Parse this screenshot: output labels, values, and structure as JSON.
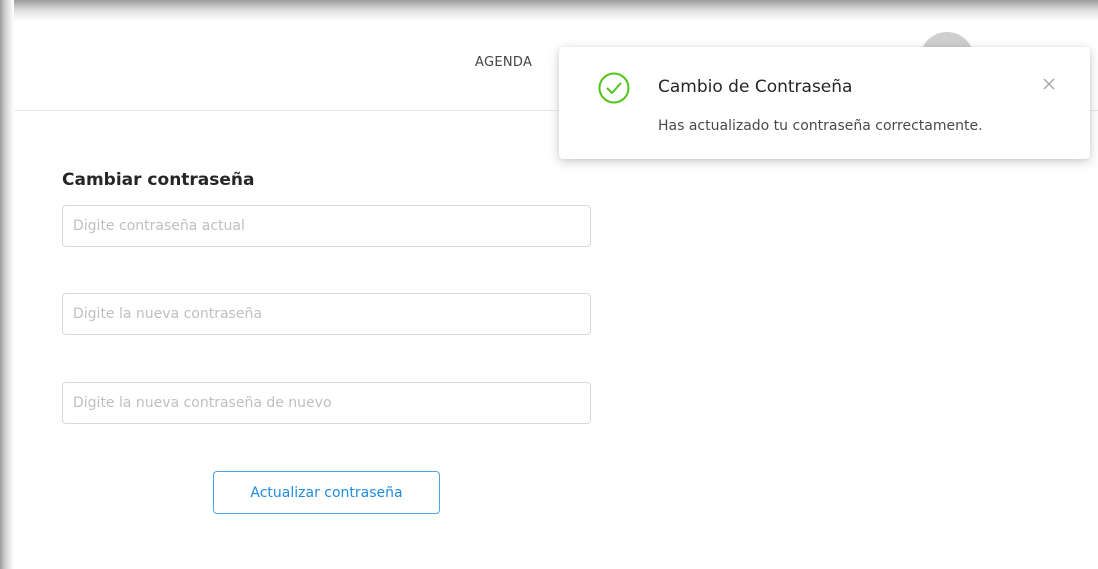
{
  "nav": {
    "agenda_label": "AGENDA"
  },
  "form": {
    "title": "Cambiar contraseña",
    "current_password": {
      "placeholder": "Digite contraseña actual",
      "value": ""
    },
    "new_password": {
      "placeholder": "Digite la nueva contraseña",
      "value": ""
    },
    "confirm_password": {
      "placeholder": "Digite la nueva contraseña de nuevo",
      "value": ""
    },
    "submit_label": "Actualizar contraseña"
  },
  "notification": {
    "title": "Cambio de Contraseña",
    "message": "Has actualizado tu contraseña correctamente.",
    "icon": "check-circle-icon",
    "close_icon": "close-icon"
  },
  "colors": {
    "success": "#52c41a",
    "primary": "#1f8ce0",
    "border": "#d9d9d9"
  }
}
